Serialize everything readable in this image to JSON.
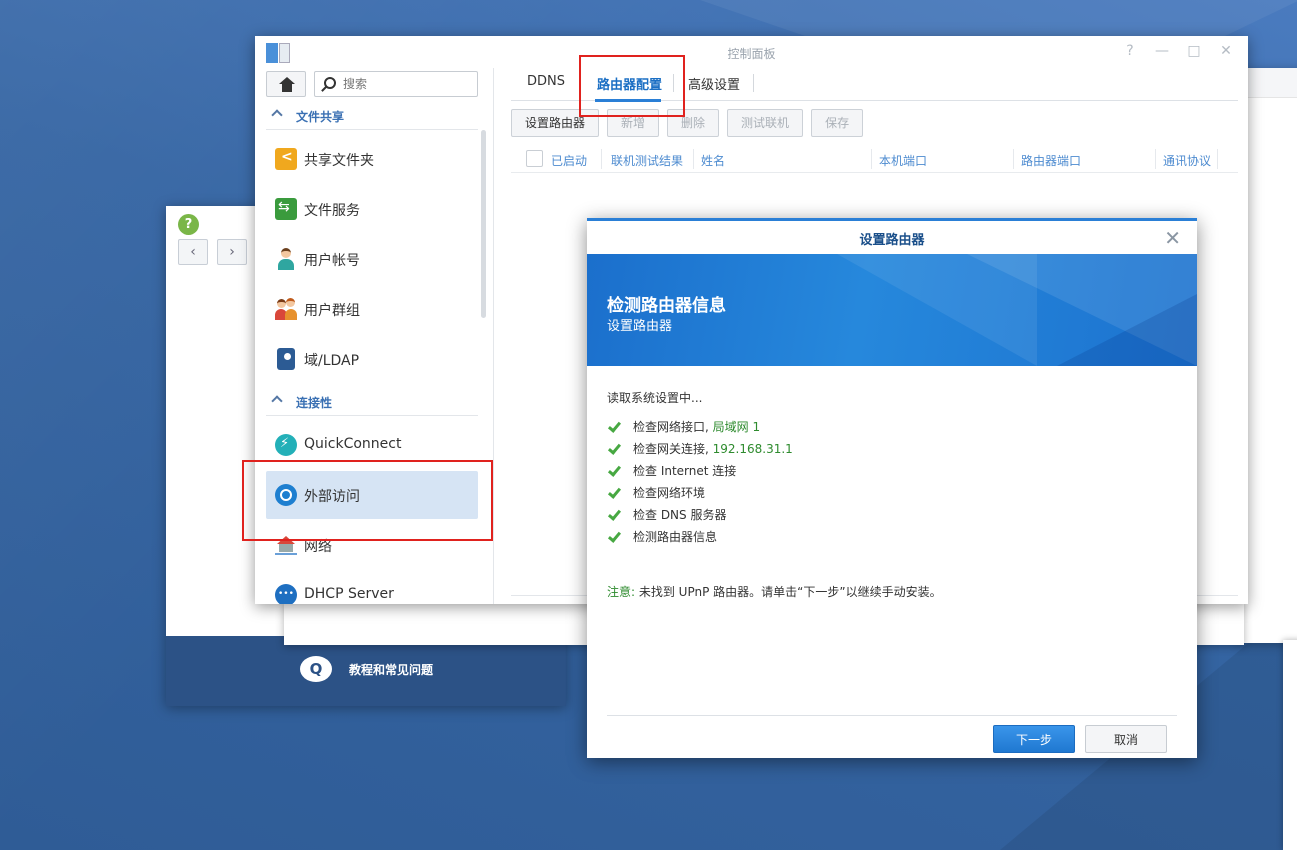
{
  "help_window": {
    "footer_label": "教程和常见问题",
    "faq_icon": "Q"
  },
  "control_panel": {
    "title": "控制面板",
    "window_controls": [
      "?",
      "—",
      "□",
      "✕"
    ],
    "search_placeholder": "搜索",
    "sections": {
      "file_sharing": "文件共享",
      "connectivity": "连接性"
    },
    "sidebar_items": [
      {
        "label": "共享文件夹",
        "icon": "shared-folder-icon"
      },
      {
        "label": "文件服务",
        "icon": "file-services-icon"
      },
      {
        "label": "用户帐号",
        "icon": "user-icon"
      },
      {
        "label": "用户群组",
        "icon": "group-icon"
      },
      {
        "label": "域/LDAP",
        "icon": "ldap-icon"
      },
      {
        "label": "QuickConnect",
        "icon": "quickconnect-icon"
      },
      {
        "label": "外部访问",
        "icon": "external-access-icon",
        "active": true
      },
      {
        "label": "网络",
        "icon": "network-icon"
      },
      {
        "label": "DHCP Server",
        "icon": "dhcp-server-icon"
      }
    ],
    "tabs": [
      "DDNS",
      "路由器配置",
      "高级设置"
    ],
    "active_tab": "路由器配置",
    "toolbar": {
      "setup_router": "设置路由器",
      "add": "新增",
      "delete": "删除",
      "test_connection": "测试联机",
      "save": "保存"
    },
    "grid_columns": [
      "已启动",
      "联机测试结果",
      "姓名",
      "本机端口",
      "路由器端口",
      "通讯协议"
    ]
  },
  "dialog": {
    "title": "设置路由器",
    "banner_title": "检测路由器信息",
    "banner_subtitle": "设置路由器",
    "reading": "读取系统设置中...",
    "checks": [
      {
        "text": "检查网络接口,",
        "value": "局域网 1"
      },
      {
        "text": "检查网关连接,",
        "value": "192.168.31.1"
      },
      {
        "text": "检查 Internet 连接",
        "value": ""
      },
      {
        "text": "检查网络环境",
        "value": ""
      },
      {
        "text": "检查 DNS 服务器",
        "value": ""
      },
      {
        "text": "检测路由器信息",
        "value": ""
      }
    ],
    "note_label": "注意:",
    "note_text": " 未找到 UPnP 路由器。请单击“下一步”以继续手动安装。",
    "next_button": "下一步",
    "cancel_button": "取消"
  },
  "colors": {
    "accent": "#2a7fd6",
    "success": "#47a842",
    "highlight": "#e0221e"
  }
}
